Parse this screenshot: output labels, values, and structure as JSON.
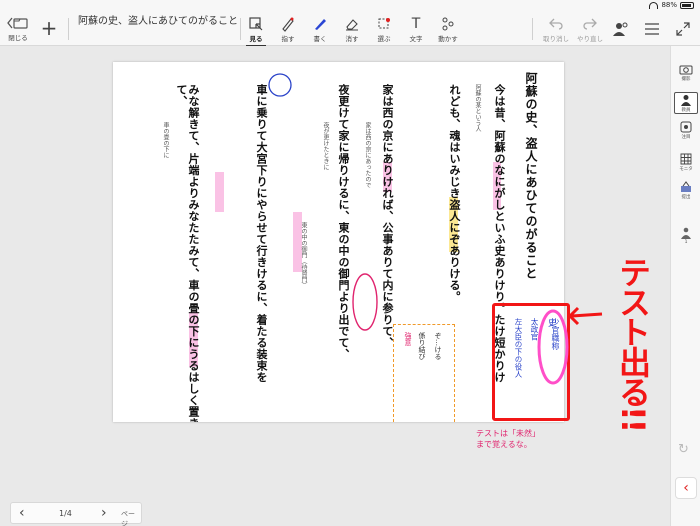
{
  "status": {
    "battery": "88%",
    "battery_level": 0.88
  },
  "toolbar": {
    "close_label": "閉じる",
    "title": "阿蘇の史、盗人にあひてのがること",
    "tools": [
      {
        "label": "見る",
        "icon": "select-icon"
      },
      {
        "label": "指す",
        "icon": "pointer-pen-icon"
      },
      {
        "label": "書く",
        "icon": "pen-icon"
      },
      {
        "label": "消す",
        "icon": "eraser-icon"
      },
      {
        "label": "選ぶ",
        "icon": "lasso-icon"
      },
      {
        "label": "文字",
        "icon": "text-icon"
      },
      {
        "label": "動かす",
        "icon": "move-icon"
      }
    ],
    "undo_label": "取り消し",
    "redo_label": "やり直し"
  },
  "rail": [
    {
      "label": "撮影",
      "icon": "camera-icon"
    },
    {
      "label": "教員",
      "icon": "teacher-icon"
    },
    {
      "label": "注目",
      "icon": "attention-icon"
    },
    {
      "label": "モニタ",
      "icon": "monitor-grid-icon"
    },
    {
      "label": "提出",
      "icon": "submit-icon"
    },
    {
      "label": "1",
      "icon": "person-icon"
    }
  ],
  "document": {
    "title": "阿蘇の史、盗人にあひてのがること",
    "lines": [
      "今は昔、阿蘇のなにがしといふ史ありけり。たけ短かりけ",
      "れども、魂はいみじき盗人にぞありける。",
      "家は西の京にありければ、公事ありて内に参りて、",
      "夜更けて家に帰りけるに、東の中の御門より出でて、",
      "車に乗りて大宮下りにやらせて行きけるに、着たる装束を",
      "みな解きて、片端よりみなたたみて、車の畳の下にうるはしく置き",
      "て、"
    ],
    "glosses": [
      "阿蘇の某という人",
      "家は西の京にあったので",
      "夜が更けたときに",
      "東の中の御門（待賢門）",
      "車の畳の下に"
    ]
  },
  "annotations": {
    "red_note": "テスト出る!!",
    "pink_note": "テストは「未然」まで覚えるな。",
    "red_box_line1": "史",
    "red_box_line2": "太政官",
    "red_box_line3": "左大臣の下の役人",
    "box_label": "少官職称",
    "dashed_line1": "ぞ…ける",
    "dashed_line2": "係り結び",
    "dashed_line3": "強意"
  },
  "pagenav": {
    "page": "1/4",
    "label": "ページ"
  }
}
